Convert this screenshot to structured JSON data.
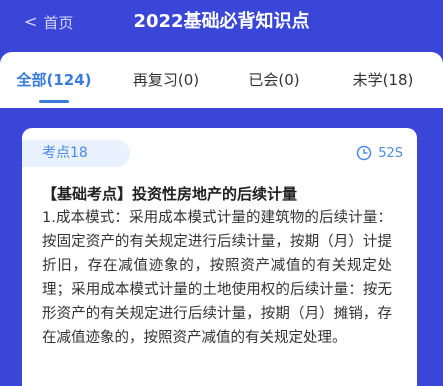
{
  "header": {
    "back_label": "首页",
    "title": "2022基础必背知识点"
  },
  "tabs": [
    {
      "label": "全部(124)",
      "active": true
    },
    {
      "label": "再复习(0)",
      "active": false
    },
    {
      "label": "已会(0)",
      "active": false
    },
    {
      "label": "未学(18)",
      "active": false
    }
  ],
  "card": {
    "badge": "考点18",
    "timer": "52S",
    "title": "【基础考点】投资性房地产的后续计量",
    "body": "1.成本模式：采用成本模式计量的建筑物的后续计量：按固定资产的有关规定进行后续计量，按期（月）计提折旧，存在减值迹象的，按照资产减值的有关规定处理；采用成本模式计量的土地使用权的后续计量：按无形资产的有关规定进行后续计量，按期（月）摊销，存在减值迹象的，按照资产减值的有关规定处理。"
  },
  "colors": {
    "brand": "#3a46d8",
    "accent": "#3a7cdb",
    "badge_bg": "#e8f1fd"
  },
  "icons": {
    "back": "chevron-left-icon",
    "timer": "clock-icon"
  }
}
